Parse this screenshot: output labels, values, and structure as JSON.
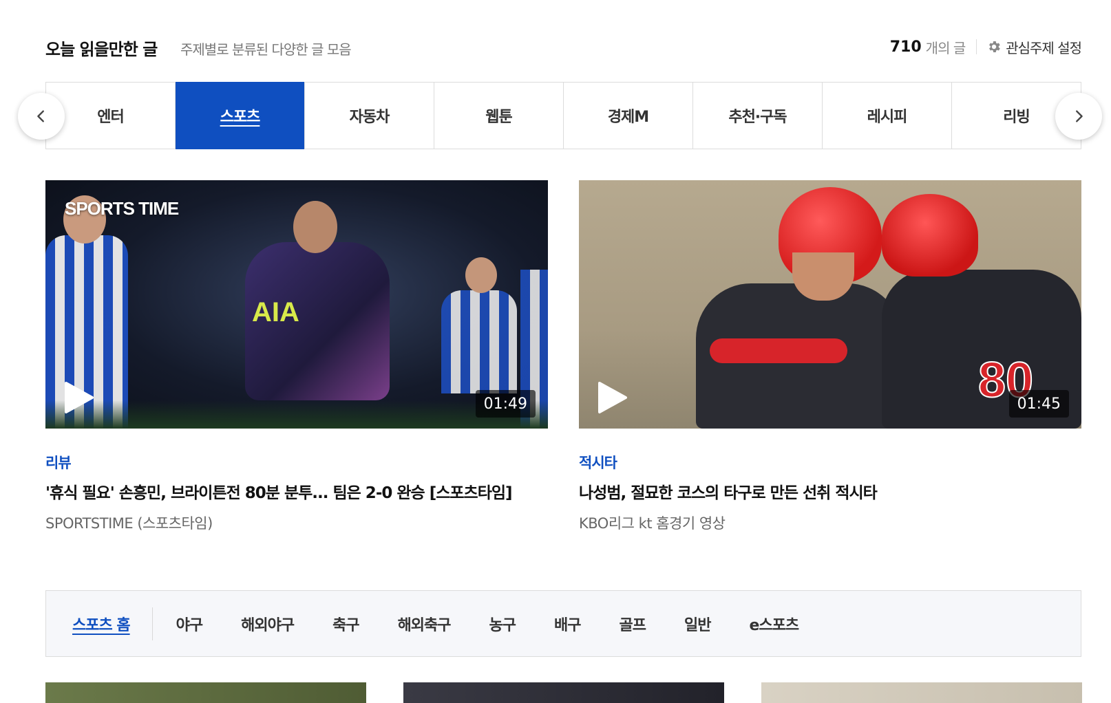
{
  "header": {
    "title": "오늘 읽을만한 글",
    "subtitle": "주제별로 분류된 다양한 글 모음",
    "count": "710",
    "count_label": "개의 글",
    "settings_label": "관심주제 설정"
  },
  "tabs": [
    {
      "label": "엔터"
    },
    {
      "label": "스포츠",
      "active": true
    },
    {
      "label": "자동차"
    },
    {
      "label": "웹툰"
    },
    {
      "label": "경제M"
    },
    {
      "label": "추천·구독"
    },
    {
      "label": "레시피"
    },
    {
      "label": "리빙"
    }
  ],
  "cards": [
    {
      "watermark": "SPORTS TIME",
      "duration": "01:49",
      "category": "리뷰",
      "title": "'휴식 필요' 손흥민, 브라이튼전 80분 분투... 팀은 2-0 완승 [스포츠타임]",
      "source": "SPORTSTIME (스포츠타임)"
    },
    {
      "duration": "01:45",
      "category": "적시타",
      "title": "나성범, 절묘한 코스의 타구로 만든 선취 적시타",
      "source": "KBO리그 kt 홈경기 영상"
    }
  ],
  "subnav": [
    {
      "label": "스포츠 홈",
      "active": true
    },
    {
      "label": "야구"
    },
    {
      "label": "해외야구"
    },
    {
      "label": "축구"
    },
    {
      "label": "해외축구"
    },
    {
      "label": "농구"
    },
    {
      "label": "배구"
    },
    {
      "label": "골프"
    },
    {
      "label": "일반"
    },
    {
      "label": "e스포츠"
    }
  ],
  "colors": {
    "accent": "#0f4fc0",
    "border": "#dcdcdc",
    "subnav_bg": "#f6f7fa"
  },
  "icons": {
    "settings": "gear-icon",
    "prev": "chevron-left-icon",
    "next": "chevron-right-icon",
    "video": "play-icon"
  }
}
